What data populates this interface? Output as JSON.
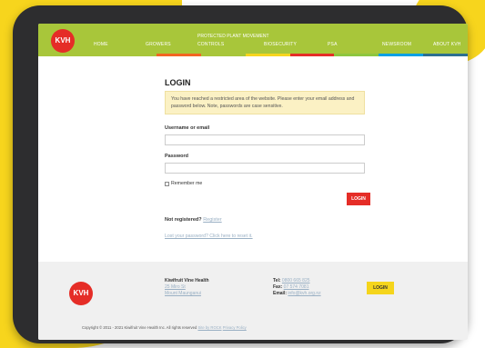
{
  "site": {
    "logo_text": "KVH",
    "nav": [
      {
        "label": "Home"
      },
      {
        "label": "Growers"
      },
      {
        "label": "Controls"
      },
      {
        "label": "Biosecurity"
      },
      {
        "label": "PSA"
      },
      {
        "label": "Newsroom"
      },
      {
        "label": "About KVH"
      }
    ],
    "nav_sub_label": "Protected Plant Movement",
    "nav_colors": [
      "#f26522",
      "#a8c63a",
      "#f7d51d",
      "#e52d27",
      "#8dc63f",
      "#00a0e4",
      "#2b6f8f"
    ]
  },
  "login": {
    "title": "LOGIN",
    "notice": "You have reached a restricted area of the website. Please enter your email address and password below. Note, passwords are case sensitive.",
    "username_label": "Username or email",
    "password_label": "Password",
    "remember_label": "Remember me",
    "button_label": "LOGIN",
    "not_registered": "Not registered?",
    "register_link": "Register",
    "lost_password": "Lost your password? Click here to reset it."
  },
  "footer": {
    "logo_text": "KVH",
    "org_name": "Kiwifruit Vine Health",
    "address1": "25 Miro St",
    "address2": "Mount Maunganui",
    "tel_label": "Tel:",
    "tel": "0800 665 825",
    "fax_label": "Fax:",
    "fax": "07 574 7081",
    "email_label": "Email:",
    "email": "info@kvh.org.nz",
    "button_label": "LOGIN",
    "copyright": "Copyright © 2011 - 2021 Kiwifruit Vine Health Inc. All rights reserved",
    "site_by": "Site by ROCK",
    "privacy": "Privacy Policy"
  }
}
